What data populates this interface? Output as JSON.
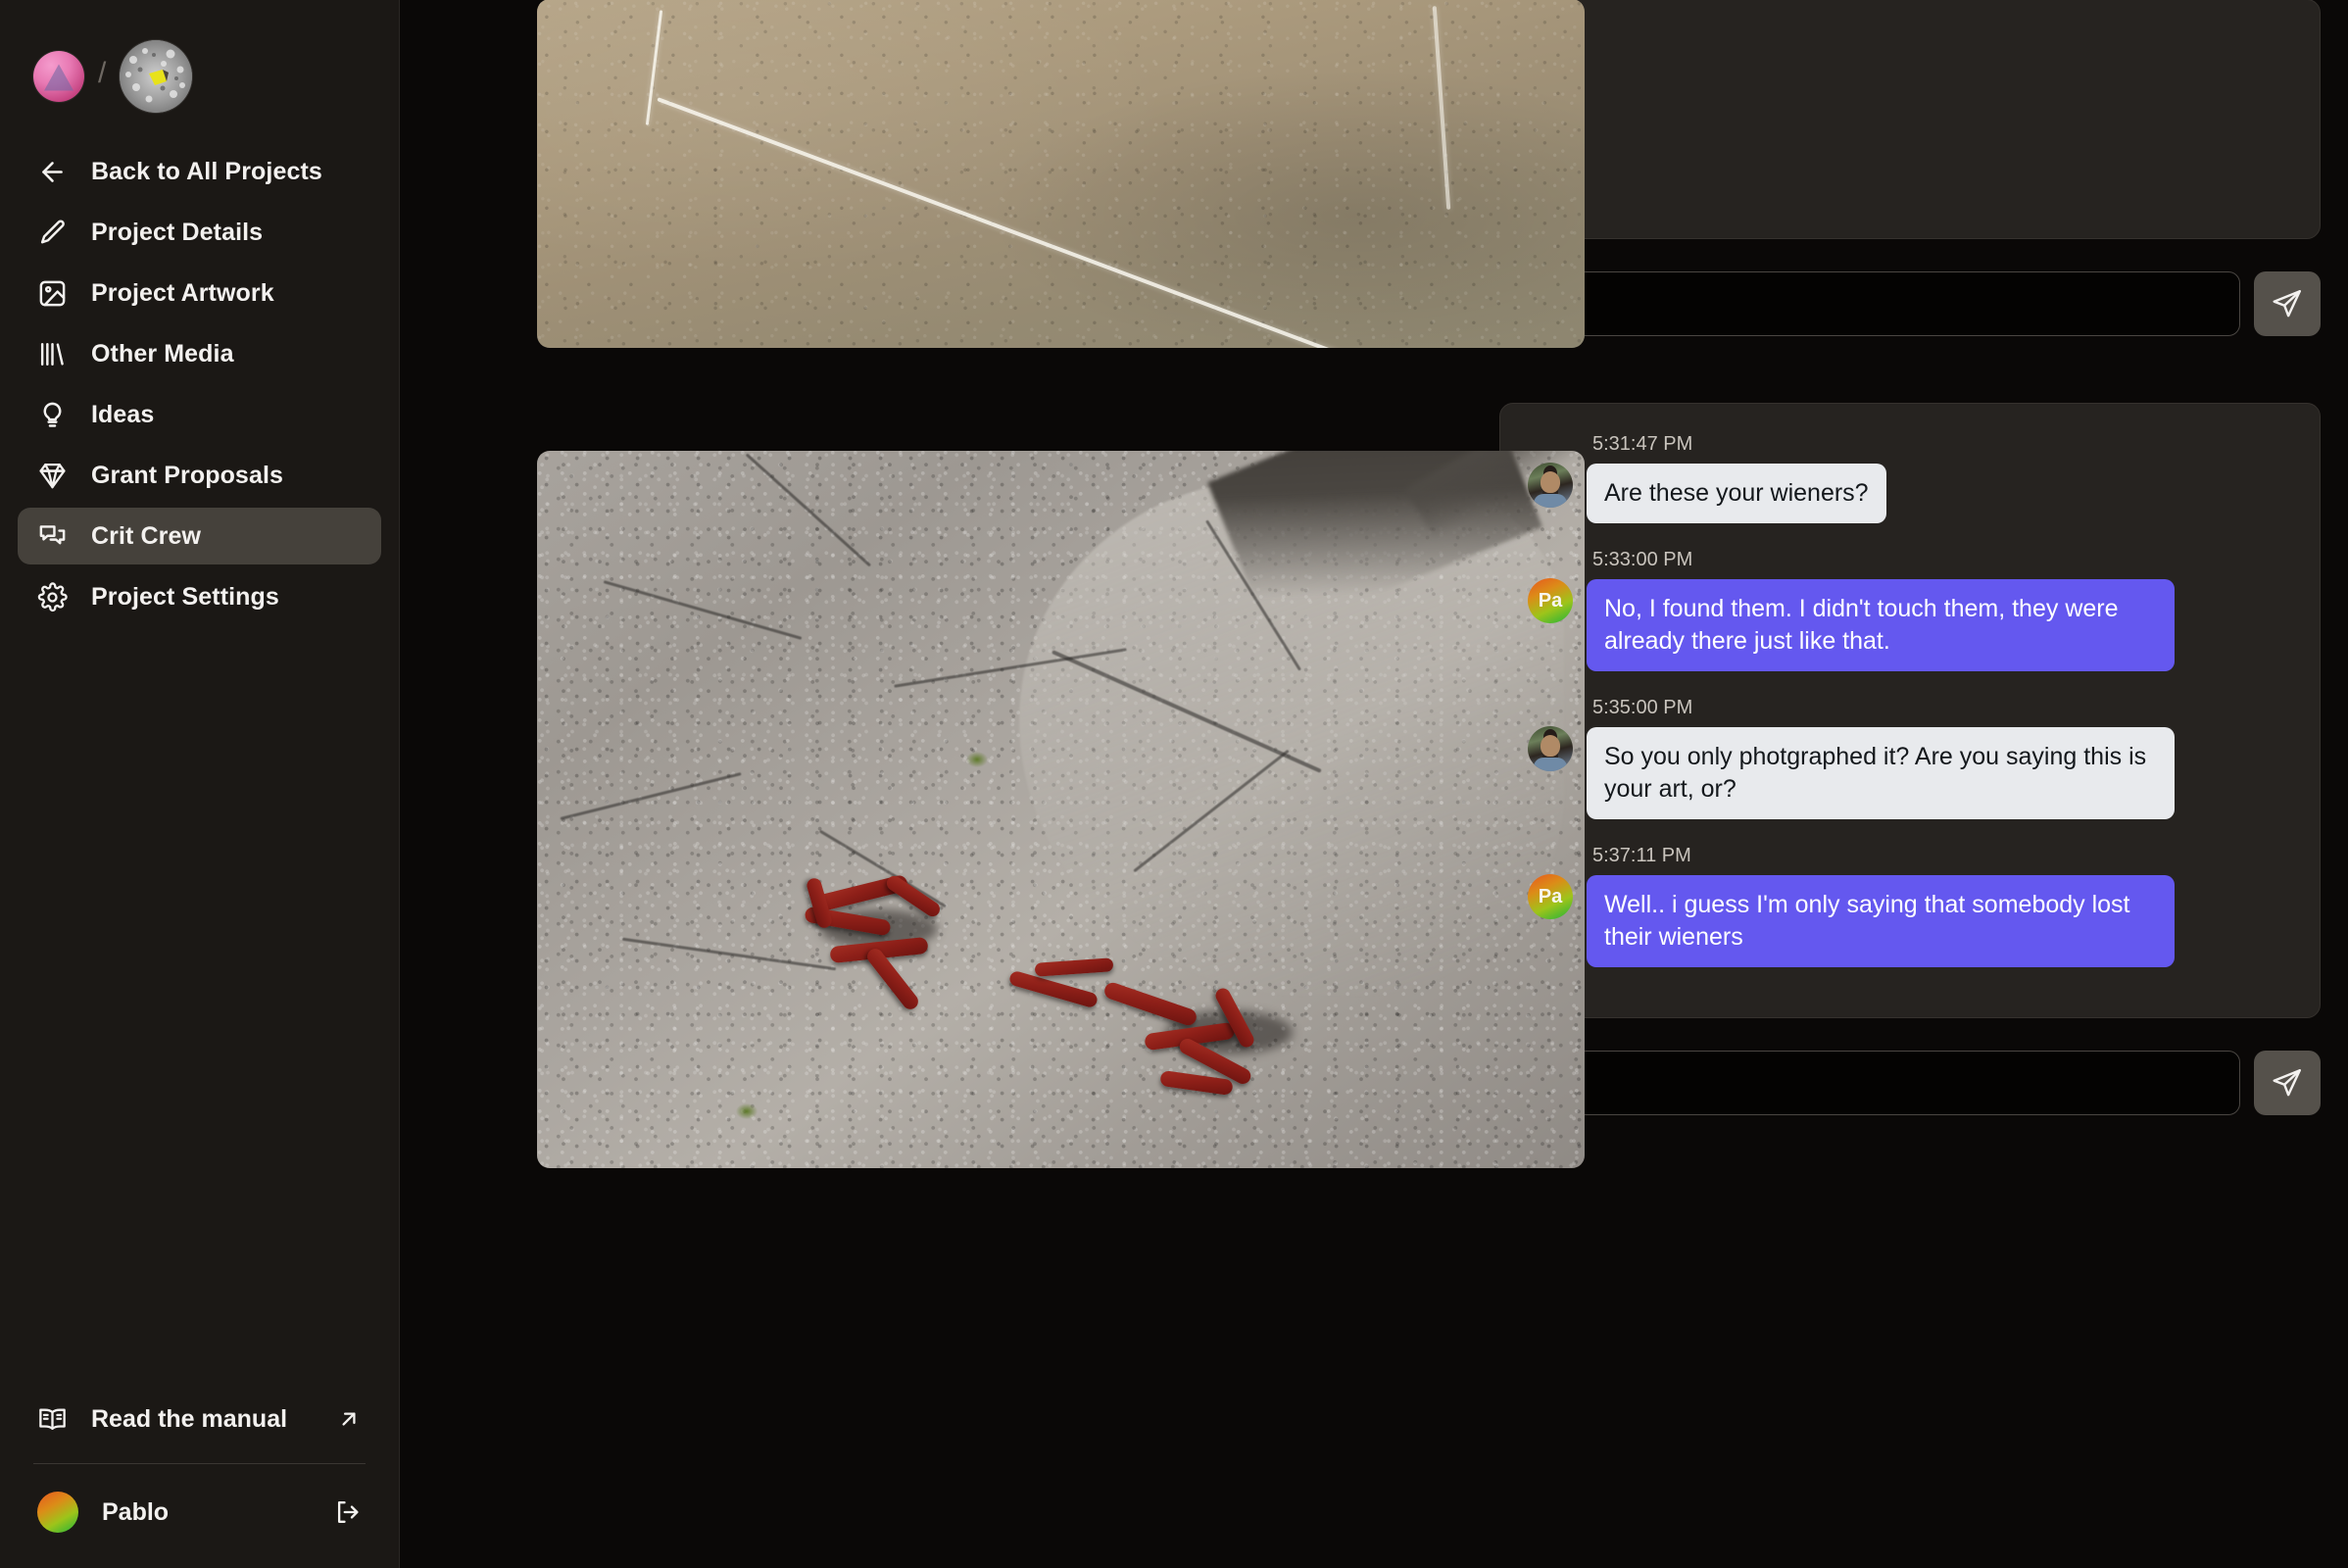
{
  "sidebar": {
    "brand": {
      "logo_icon": "pyramid-logo-icon",
      "separator": "/",
      "project_avatar_icon": "project-thumbnail-avatar"
    },
    "nav": [
      {
        "label": "Back to All Projects",
        "icon": "arrow-left-icon",
        "active": false
      },
      {
        "label": "Project Details",
        "icon": "pencil-icon",
        "active": false
      },
      {
        "label": "Project Artwork",
        "icon": "image-icon",
        "active": false
      },
      {
        "label": "Other Media",
        "icon": "books-icon",
        "active": false
      },
      {
        "label": "Ideas",
        "icon": "lightbulb-icon",
        "active": false
      },
      {
        "label": "Grant Proposals",
        "icon": "diamond-icon",
        "active": false
      },
      {
        "label": "Crit Crew",
        "icon": "chat-bubbles-icon",
        "active": true
      },
      {
        "label": "Project Settings",
        "icon": "gear-icon",
        "active": false
      }
    ],
    "footer": {
      "manual_label": "Read the manual",
      "manual_icon": "open-book-icon",
      "manual_external_icon": "arrow-up-right-icon",
      "user_name": "Pablo",
      "user_avatar_icon": "user-gradient-avatar",
      "logout_icon": "logout-icon"
    }
  },
  "artwork": [
    {
      "name": "chalk-lines-on-dirt-photo",
      "alt": "Tan dirt ground with white chalk lines forming an angle"
    },
    {
      "name": "red-sausages-on-concrete-photo",
      "alt": "Red sausage links scattered on cracked gray concrete"
    }
  ],
  "chat": {
    "top_panel": {
      "messages": []
    },
    "top_composer": {
      "value": "",
      "placeholder": "",
      "send_icon": "send-paper-plane-icon"
    },
    "bottom_composer": {
      "value": "",
      "placeholder": "",
      "send_icon": "send-paper-plane-icon"
    },
    "messages": [
      {
        "time": "5:31:47 PM",
        "text": "Are these your wieners?",
        "direction": "incoming",
        "avatar_type": "photo",
        "initials": ""
      },
      {
        "time": "5:33:00 PM",
        "text": "No, I found them. I didn't touch them, they were already there just like that.",
        "direction": "outgoing",
        "avatar_type": "initials",
        "initials": "Pa"
      },
      {
        "time": "5:35:00 PM",
        "text": "So you only photgraphed it? Are you saying this is your art, or?",
        "direction": "incoming",
        "avatar_type": "photo",
        "initials": ""
      },
      {
        "time": "5:37:11 PM",
        "text": "Well.. i guess I'm only saying that somebody lost their wieners",
        "direction": "outgoing",
        "avatar_type": "initials",
        "initials": "Pa"
      }
    ]
  },
  "colors": {
    "page_background": "#0a0807",
    "sidebar_background": "#1b1815",
    "active_nav_background": "#45413b",
    "chat_panel_background": "#262320",
    "outgoing_bubble": "#6458ef",
    "incoming_bubble": "#e8eaed",
    "send_button": "#55514b"
  }
}
